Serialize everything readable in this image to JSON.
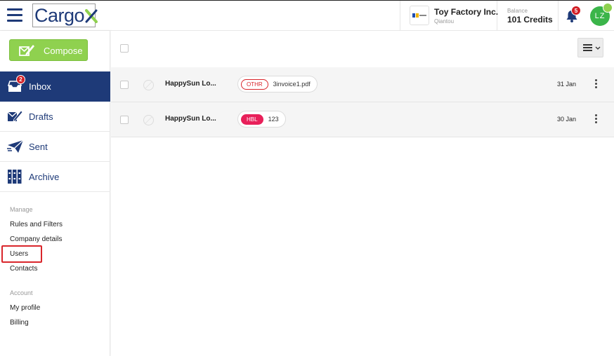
{
  "header": {
    "logo_text": "Cargo",
    "logo_mark": "X",
    "company": {
      "name": "Toy Factory Inc.",
      "city": "Qiantou"
    },
    "balance": {
      "label": "Balance",
      "value": "101 Credits"
    },
    "notifications_count": "5",
    "avatar_initials": "LZ"
  },
  "sidebar": {
    "compose_label": "Compose",
    "nav": [
      {
        "label": "Inbox",
        "icon": "inbox-icon",
        "badge": "2",
        "active": true
      },
      {
        "label": "Drafts",
        "icon": "drafts-icon"
      },
      {
        "label": "Sent",
        "icon": "sent-icon"
      },
      {
        "label": "Archive",
        "icon": "archive-icon"
      }
    ],
    "manage": {
      "title": "Manage",
      "links": [
        "Rules and Filters",
        "Company details",
        "Users",
        "Contacts"
      ]
    },
    "account": {
      "title": "Account",
      "links": [
        "My profile",
        "Billing"
      ]
    }
  },
  "messages": [
    {
      "sender": "HappySun Lo...",
      "tag": "OTHR",
      "attachment": "3invoice1.pdf",
      "date": "31 Jan"
    },
    {
      "sender": "HappySun Lo...",
      "tag": "HBL",
      "attachment": "123",
      "date": "30 Jan"
    }
  ],
  "colors": {
    "brand": "#1e3a78",
    "compose_green": "#8fd14f",
    "badge_red": "#d21f26",
    "hbl_pink": "#e8205a"
  }
}
